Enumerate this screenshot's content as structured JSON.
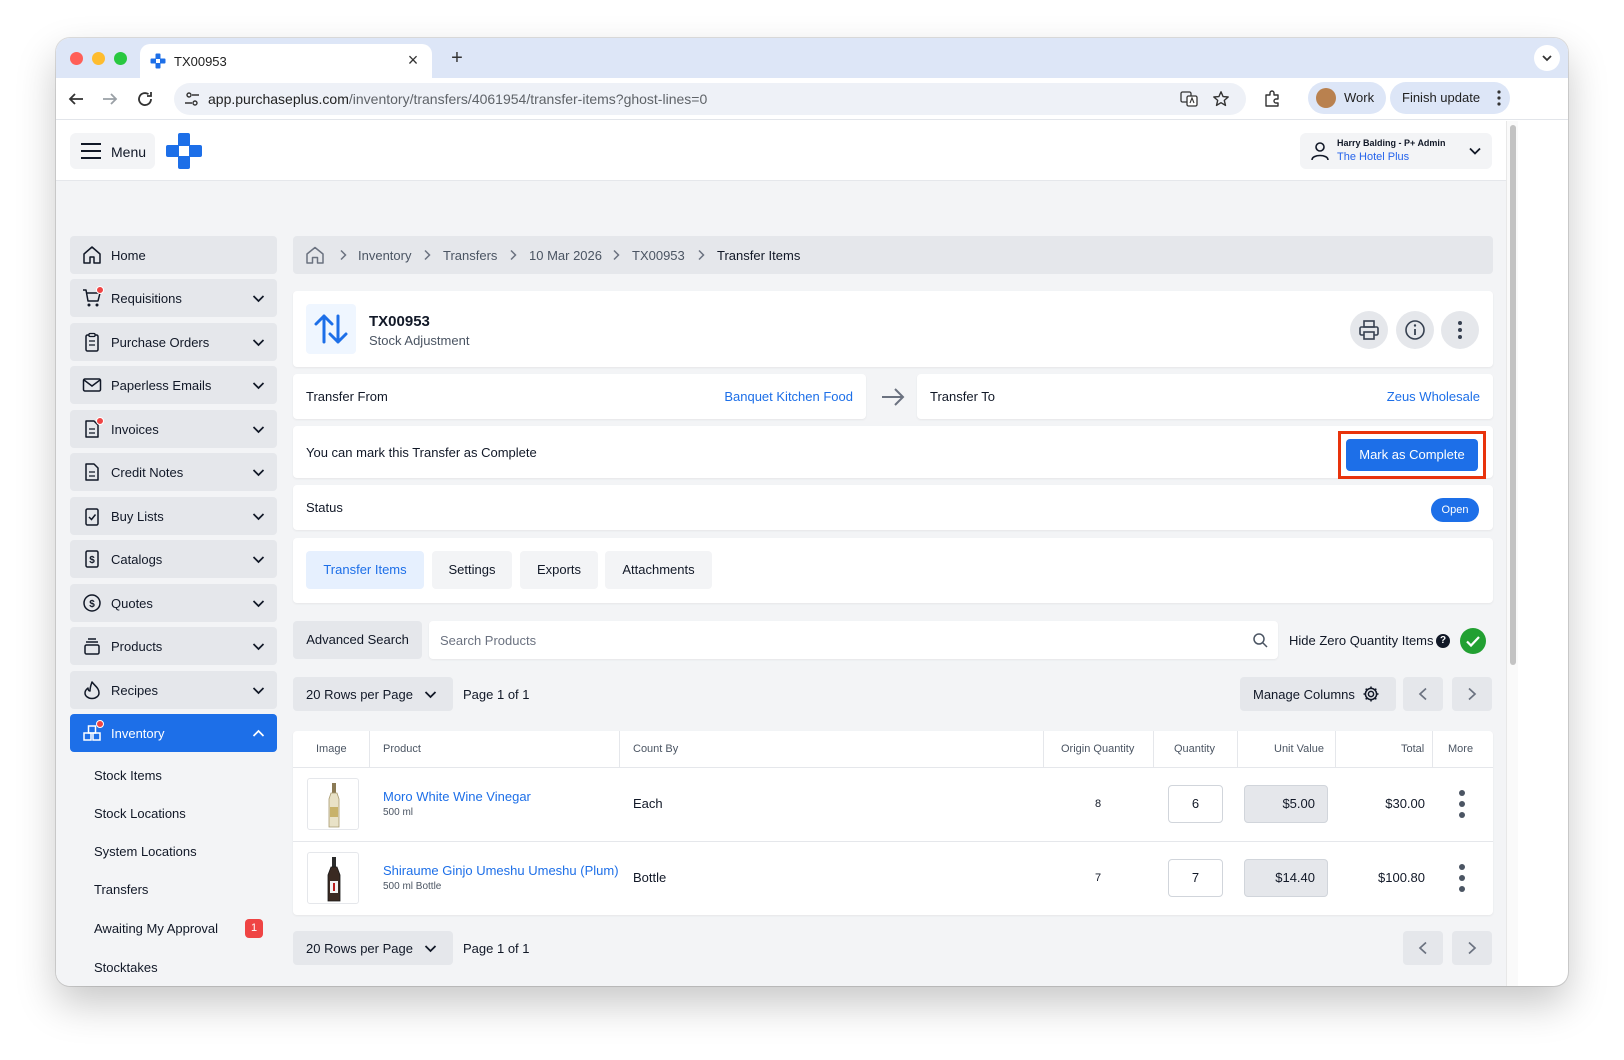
{
  "browser": {
    "tab_title": "TX00953",
    "url_host": "app.purchaseplus.com",
    "url_path": "/inventory/transfers/4061954/transfer-items?ghost-lines=0",
    "profile_label": "Work",
    "finish_update_label": "Finish update"
  },
  "header": {
    "menu_label": "Menu",
    "user_name": "Harry Balding - P+ Admin",
    "user_org": "The Hotel Plus"
  },
  "sidebar": {
    "items": [
      {
        "label": "Home",
        "icon": "home-icon"
      },
      {
        "label": "Requisitions",
        "icon": "cart-icon"
      },
      {
        "label": "Purchase Orders",
        "icon": "clipboard-icon"
      },
      {
        "label": "Paperless Emails",
        "icon": "envelope-icon"
      },
      {
        "label": "Invoices",
        "icon": "invoice-icon"
      },
      {
        "label": "Credit Notes",
        "icon": "document-icon"
      },
      {
        "label": "Buy Lists",
        "icon": "checklist-icon"
      },
      {
        "label": "Catalogs",
        "icon": "dollar-document-icon"
      },
      {
        "label": "Quotes",
        "icon": "dollar-circle-icon"
      },
      {
        "label": "Products",
        "icon": "stack-icon"
      },
      {
        "label": "Recipes",
        "icon": "fire-icon"
      },
      {
        "label": "Inventory",
        "icon": "boxes-icon"
      }
    ],
    "inventory_sub": [
      "Stock Items",
      "Stock Locations",
      "System Locations",
      "Transfers",
      "Awaiting My Approval",
      "Stocktakes"
    ],
    "approval_badge": "1"
  },
  "breadcrumb": [
    "Inventory",
    "Transfers",
    "10 Mar 2026",
    "TX00953",
    "Transfer Items"
  ],
  "transfer": {
    "number": "TX00953",
    "type": "Stock Adjustment",
    "from_label": "Transfer From",
    "from_value": "Banquet Kitchen Food",
    "to_label": "Transfer To",
    "to_value": "Zeus Wholesale",
    "complete_message": "You can mark this Transfer as Complete",
    "complete_button": "Mark as Complete",
    "status_label": "Status",
    "status_value": "Open"
  },
  "tabs": [
    "Transfer Items",
    "Settings",
    "Exports",
    "Attachments"
  ],
  "toolbar": {
    "advanced_search": "Advanced Search",
    "search_placeholder": "Search Products",
    "hide_zero_label": "Hide Zero Quantity Items",
    "rows_per_page": "20 Rows per Page",
    "page_info": "Page 1 of 1",
    "manage_columns": "Manage Columns"
  },
  "table": {
    "columns": [
      "Image",
      "Product",
      "Count By",
      "Origin Quantity",
      "Quantity",
      "Unit Value",
      "Total",
      "More"
    ],
    "rows": [
      {
        "product": "Moro White Wine Vinegar",
        "size": "500 ml",
        "count_by": "Each",
        "origin_qty": "8",
        "qty": "6",
        "unit_value": "$5.00",
        "total": "$30.00"
      },
      {
        "product": "Shiraume Ginjo Umeshu Umeshu (Plum)",
        "size": "500 ml Bottle",
        "count_by": "Bottle",
        "origin_qty": "7",
        "qty": "7",
        "unit_value": "$14.40",
        "total": "$100.80"
      }
    ]
  },
  "colors": {
    "primary": "#1d6fe8",
    "highlight": "#e8330c",
    "success": "#22a032",
    "alert": "#ef4444"
  }
}
